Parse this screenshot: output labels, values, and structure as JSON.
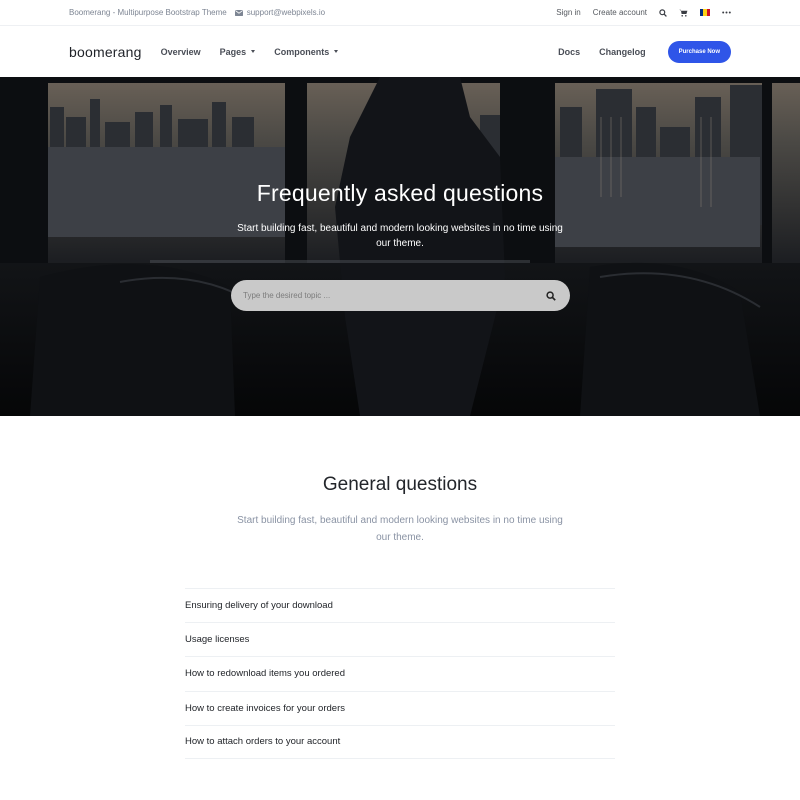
{
  "topbar": {
    "site_title": "Boomerang - Multipurpose Bootstrap Theme",
    "email": "support@webpixels.io",
    "sign_in": "Sign in",
    "create_account": "Create account",
    "flag_colors": [
      "#002b7f",
      "#fcd116",
      "#ce1126"
    ]
  },
  "navbar": {
    "brand": "boomerang",
    "links": [
      "Overview",
      "Pages",
      "Components"
    ],
    "right_links": [
      "Docs",
      "Changelog"
    ],
    "purchase": "Purchase Now",
    "accent": "#2f55e8"
  },
  "hero": {
    "title": "Frequently asked questions",
    "subtitle": "Start building fast, beautiful and modern looking websites in no time using our theme.",
    "search_placeholder": "Type the desired topic ..."
  },
  "general": {
    "title": "General questions",
    "subtitle": "Start building fast, beautiful and modern looking websites in no time using our theme."
  },
  "faq": [
    "Ensuring delivery of your download",
    "Usage licenses",
    "How to redownload items you ordered",
    "How to create invoices for your orders",
    "How to attach orders to your account"
  ]
}
